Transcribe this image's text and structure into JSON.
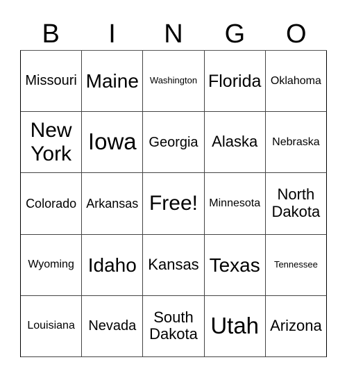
{
  "header": {
    "letters": [
      "B",
      "I",
      "N",
      "G",
      "O"
    ]
  },
  "cells": [
    {
      "text": "Missouri"
    },
    {
      "text": "Maine"
    },
    {
      "text": "Washington"
    },
    {
      "text": "Florida"
    },
    {
      "text": "Oklahoma"
    },
    {
      "text": "New York"
    },
    {
      "text": "Iowa"
    },
    {
      "text": "Georgia"
    },
    {
      "text": "Alaska"
    },
    {
      "text": "Nebraska"
    },
    {
      "text": "Colorado"
    },
    {
      "text": "Arkansas"
    },
    {
      "text": "Free!"
    },
    {
      "text": "Minnesota"
    },
    {
      "text": "North Dakota"
    },
    {
      "text": "Wyoming"
    },
    {
      "text": "Idaho"
    },
    {
      "text": "Kansas"
    },
    {
      "text": "Texas"
    },
    {
      "text": "Tennessee"
    },
    {
      "text": "Louisiana"
    },
    {
      "text": "Nevada"
    },
    {
      "text": "South Dakota"
    },
    {
      "text": "Utah"
    },
    {
      "text": "Arizona"
    }
  ]
}
